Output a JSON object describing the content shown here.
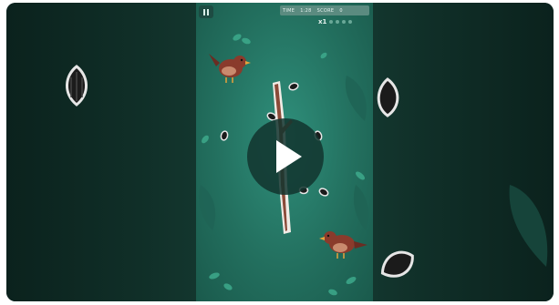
{
  "hud": {
    "time_label": "TIME",
    "time_value": "1:28",
    "score_label": "SCORE",
    "score_value": "0",
    "multiplier": "x1"
  },
  "icons": {
    "pause": "pause-icon",
    "play": "play-icon",
    "seed": "sunflower-seed-icon",
    "bird": "sparrow-icon",
    "branch": "branch-icon"
  },
  "colors": {
    "game_bg": "#23705f",
    "side_bg": "#0e2a24",
    "bird_body": "#8a3b2c",
    "branch": "#8a4a38",
    "seed": "#1b1b1b"
  }
}
